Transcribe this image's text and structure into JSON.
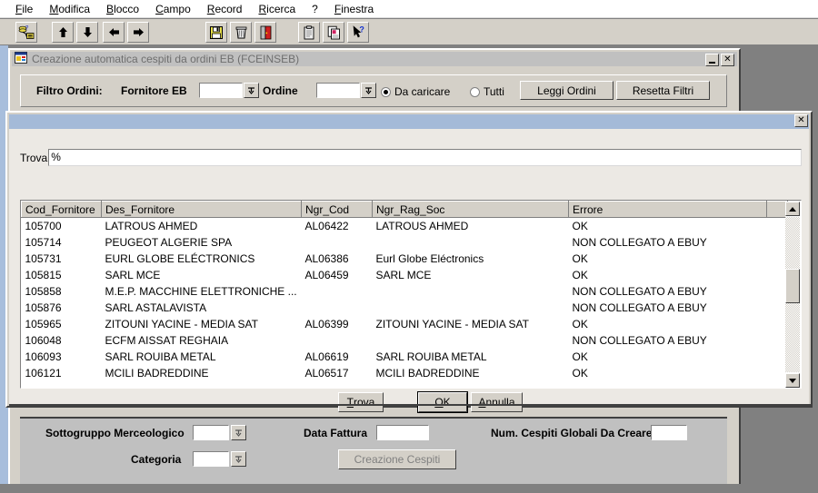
{
  "menubar": {
    "items": [
      {
        "label": "File",
        "accel": "F"
      },
      {
        "label": "Modifica",
        "accel": "M"
      },
      {
        "label": "Blocco",
        "accel": "B"
      },
      {
        "label": "Campo",
        "accel": "C"
      },
      {
        "label": "Record",
        "accel": "R"
      },
      {
        "label": "Ricerca",
        "accel": "R"
      },
      {
        "label": "?",
        "accel": ""
      },
      {
        "label": "Finestra",
        "accel": "F"
      }
    ]
  },
  "toolbar": {
    "buttons": [
      {
        "name": "enter-query-icon",
        "tip": "Esegui query"
      },
      {
        "name": "arrow-up-icon",
        "tip": "Record precedente"
      },
      {
        "name": "arrow-down-icon",
        "tip": "Record successivo"
      },
      {
        "name": "arrow-left-icon",
        "tip": "Blocco precedente"
      },
      {
        "name": "arrow-right-icon",
        "tip": "Blocco successivo"
      },
      {
        "name": "save-floppy-icon",
        "tip": "Salva"
      },
      {
        "name": "trash-icon",
        "tip": "Elimina record"
      },
      {
        "name": "exit-door-icon",
        "tip": "Esci"
      },
      {
        "name": "clipboard-icon",
        "tip": "Lista valori"
      },
      {
        "name": "copy-records-icon",
        "tip": "Duplica record"
      },
      {
        "name": "help-arrow-icon",
        "tip": "Guida"
      }
    ]
  },
  "child_window": {
    "title": "Creazione automatica cespiti da ordini EB (FCEINSEB)",
    "icon": "form-window-icon",
    "minimize_label": "_",
    "close_label": "✕"
  },
  "filter_panel": {
    "group_label": "Filtro Ordini:",
    "fornitore_label": "Fornitore EB",
    "fornitore_value": "",
    "ordine_label": "Ordine",
    "ordine_value": "",
    "radio_da_caricare": "Da caricare",
    "radio_tutti": "Tutti",
    "radio_selected": "Da caricare",
    "leggi_ordini_button": "Leggi Ordini",
    "resetta_filtri_button": "Resetta Filtri"
  },
  "bottom_panel": {
    "sottogruppo_label": "Sottogruppo Merceologico",
    "sottogruppo_value": "",
    "categoria_label": "Categoria",
    "categoria_value": "",
    "data_fattura_label": "Data Fattura",
    "data_fattura_value": "",
    "num_cespiti_label": "Num. Cespiti Globali Da Creare",
    "num_cespiti_value": "",
    "creazione_cespiti_button": "Creazione Cespiti",
    "creazione_cespiti_enabled": false
  },
  "lov_dialog": {
    "close_label": "✕",
    "find_label": "Trova",
    "find_value": "%",
    "columns": [
      "Cod_Fornitore",
      "Des_Fornitore",
      "Ngr_Cod",
      "Ngr_Rag_Soc",
      "Errore",
      ""
    ],
    "rows": [
      [
        "105700",
        "LATROUS AHMED",
        "AL06422",
        "LATROUS AHMED",
        "OK",
        ""
      ],
      [
        "105714",
        "PEUGEOT ALGERIE SPA",
        "",
        "",
        "NON COLLEGATO A EBUY",
        ""
      ],
      [
        "105731",
        "EURL GLOBE ELÉCTRONICS",
        "AL06386",
        "Eurl Globe Eléctronics",
        "OK",
        ""
      ],
      [
        "105815",
        "SARL MCE",
        "AL06459",
        "SARL MCE",
        "OK",
        ""
      ],
      [
        "105858",
        "M.E.P. MACCHINE ELETTRONICHE ...",
        "",
        "",
        "NON COLLEGATO A EBUY",
        ""
      ],
      [
        "105876",
        "SARL ASTALAVISTA",
        "",
        "",
        "NON COLLEGATO A EBUY",
        ""
      ],
      [
        "105965",
        "ZITOUNI YACINE - MEDIA SAT",
        "AL06399",
        "ZITOUNI YACINE - MEDIA SAT",
        "OK",
        ""
      ],
      [
        "106048",
        "ECFM AISSAT REGHAIA",
        "",
        "",
        "NON COLLEGATO A EBUY",
        ""
      ],
      [
        "106093",
        "SARL ROUIBA METAL",
        "AL06619",
        "SARL ROUIBA METAL",
        "OK",
        ""
      ],
      [
        "106121",
        "MCILI BADREDDINE",
        "AL06517",
        "MCILI BADREDDINE",
        "OK",
        ""
      ]
    ],
    "buttons": {
      "trova": "Trova",
      "ok": "OK",
      "annulla": "Annulla"
    },
    "scrollbar": {
      "up_arrow": "up-arrow-icon",
      "down_arrow": "down-arrow-icon"
    }
  },
  "colors": {
    "face": "#d4d0c8",
    "dialog_titlebar": "#a4bad8",
    "desktop": "#808080",
    "left_strip": "#a8bedc",
    "lov_body": "#ece9e4",
    "bottom_panel": "#c0c0c0"
  }
}
